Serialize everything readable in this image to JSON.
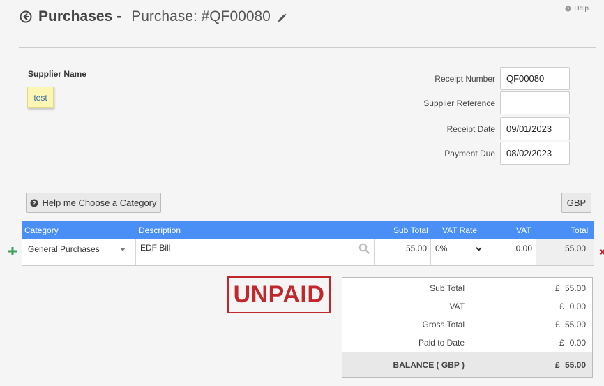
{
  "header": {
    "title": "Purchases",
    "separator": "-",
    "subtitle": "Purchase: #QF00080",
    "help_label": "Help"
  },
  "supplier": {
    "label": "Supplier Name",
    "value": "test"
  },
  "fields": {
    "receipt_number": {
      "label": "Receipt Number",
      "value": "QF00080"
    },
    "supplier_reference": {
      "label": "Supplier Reference",
      "value": ""
    },
    "receipt_date": {
      "label": "Receipt Date",
      "value": "09/01/2023"
    },
    "payment_due": {
      "label": "Payment Due",
      "value": "08/02/2023"
    }
  },
  "buttons": {
    "category_help": "Help me Choose a Category",
    "currency": "GBP"
  },
  "grid": {
    "columns": {
      "category": "Category",
      "description": "Description",
      "sub_total": "Sub Total",
      "vat_rate": "VAT Rate",
      "vat": "VAT",
      "total": "Total"
    },
    "rows": [
      {
        "category": "General Purchases",
        "description": "EDF Bill",
        "sub_total": "55.00",
        "vat_rate": "0%",
        "vat": "0.00",
        "total": "55.00"
      }
    ]
  },
  "status_stamp": "UNPAID",
  "summary": {
    "currency_symbol": "£",
    "sub_total": {
      "label": "Sub Total",
      "value": "55.00"
    },
    "vat": {
      "label": "VAT",
      "value": "0.00"
    },
    "gross_total": {
      "label": "Gross Total",
      "value": "55.00"
    },
    "paid_to_date": {
      "label": "Paid to Date",
      "value": "0.00"
    },
    "balance": {
      "label": "BALANCE ( GBP )",
      "value": "55.00"
    }
  },
  "colors": {
    "grid_header": "#4a8ff5",
    "stamp": "#c0282c",
    "add_icon": "#3aa35a",
    "remove_icon": "#c0282c",
    "supplier_chip": "#fbf6b3"
  }
}
